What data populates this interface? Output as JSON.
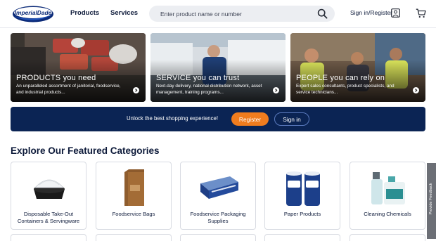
{
  "header": {
    "logo_text": "ImperialDade",
    "nav": {
      "products": "Products",
      "services": "Services"
    },
    "search": {
      "placeholder": "Enter product name or number"
    },
    "signin_label": "Sign in/Register"
  },
  "hero_cards": [
    {
      "title": "PRODUCTS you need",
      "desc": "An unparalleled assortment of janitorial, foodservice, and industrial products..."
    },
    {
      "title": "SERVICE you can trust",
      "desc": "Next-day delivery, national distribution network, asset management, training programs..."
    },
    {
      "title": "PEOPLE you can rely on",
      "desc": "Expert sales consultants, product specialists, and service technicians..."
    }
  ],
  "banner": {
    "text": "Unlock the best shopping experience!",
    "register_label": "Register",
    "signin_label": "Sign in"
  },
  "categories": {
    "title": "Explore Our Featured Categories",
    "items": [
      {
        "label": "Disposable Take-Out Containers & Servingware"
      },
      {
        "label": "Foodservice Bags"
      },
      {
        "label": "Foodservice Packaging Supplies"
      },
      {
        "label": "Paper Products"
      },
      {
        "label": "Cleaning Chemicals"
      }
    ]
  },
  "feedback_tab": "Provide Feedback",
  "colors": {
    "navy": "#0b2454",
    "orange": "#f07c1e",
    "text": "#0d1a3a"
  }
}
